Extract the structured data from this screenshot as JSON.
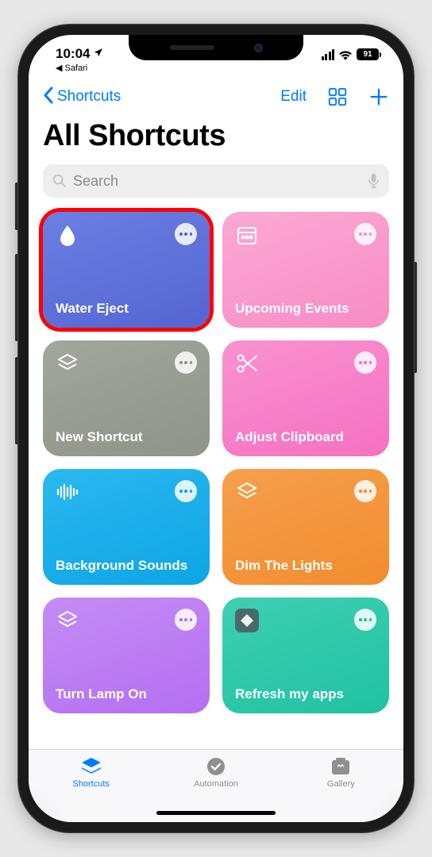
{
  "status": {
    "time": "10:04",
    "back_app": "Safari",
    "battery": "91"
  },
  "nav": {
    "back_label": "Shortcuts",
    "edit_label": "Edit"
  },
  "page": {
    "title": "All Shortcuts"
  },
  "search": {
    "placeholder": "Search"
  },
  "shortcuts": [
    {
      "label": "Water Eject",
      "icon": "droplet",
      "highlighted": true
    },
    {
      "label": "Upcoming Events",
      "icon": "calendar",
      "highlighted": false
    },
    {
      "label": "New Shortcut",
      "icon": "layers",
      "highlighted": false
    },
    {
      "label": "Adjust Clipboard",
      "icon": "scissors",
      "highlighted": false
    },
    {
      "label": "Background Sounds",
      "icon": "soundwave",
      "highlighted": false
    },
    {
      "label": "Dim The Lights",
      "icon": "layers",
      "highlighted": false
    },
    {
      "label": "Turn Lamp On",
      "icon": "layers",
      "highlighted": false
    },
    {
      "label": "Refresh my apps",
      "icon": "refresh-app",
      "highlighted": false
    }
  ],
  "tabs": {
    "shortcuts": "Shortcuts",
    "automation": "Automation",
    "gallery": "Gallery"
  }
}
